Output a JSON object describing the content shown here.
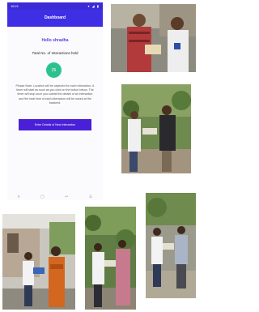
{
  "status_bar": {
    "time": "16:21",
    "icons": "▾ ◢ ▮"
  },
  "app_bar": {
    "title": "Dashboard"
  },
  "dashboard": {
    "greeting": "Hello shradha",
    "total_label": "Total No. of Interactions held",
    "total_count": "25",
    "note": "Please Note: Location will be captured for each interaction. A timer will start as soon as you click on the button below. The timer will stop once you submit the details of an interaction and the total time of each interaction will be saved at the backend.",
    "enter_button": "Enter Details of New Interaction"
  },
  "navbar": {
    "menu_icon": "≡",
    "home_icon": "▢",
    "back_icon": "↩",
    "person_icon": "♙"
  },
  "photos": [
    {
      "name": "photo-interaction-1"
    },
    {
      "name": "photo-interaction-2"
    },
    {
      "name": "photo-interaction-3"
    },
    {
      "name": "photo-interaction-4"
    },
    {
      "name": "photo-interaction-5"
    }
  ]
}
